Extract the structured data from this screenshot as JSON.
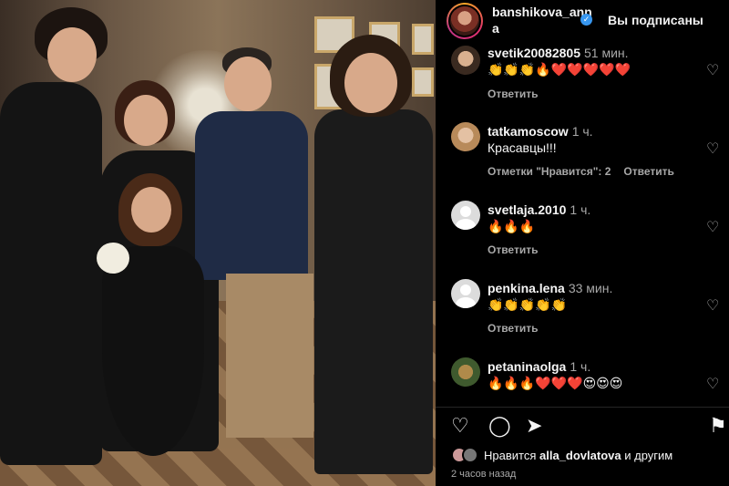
{
  "post": {
    "author": "banshikova_anna",
    "follow_status": "Вы подписаны",
    "verified_icon": "✓"
  },
  "comments": [
    {
      "user": "svetik20082805",
      "time": "51 мин.",
      "text": "👏👏👏🔥❤️❤️❤️❤️❤️",
      "reply": "Ответить",
      "likes": ""
    },
    {
      "user": "tatkamoscow",
      "time": "1 ч.",
      "text": "Красавцы!!!",
      "reply": "Ответить",
      "likes": "Отметки \"Нравится\": 2"
    },
    {
      "user": "svetlaja.2010",
      "time": "1 ч.",
      "text": "🔥🔥🔥",
      "reply": "Ответить",
      "likes": ""
    },
    {
      "user": "penkina.lena",
      "time": "33 мин.",
      "text": "👏👏👏👏👏",
      "reply": "Ответить",
      "likes": ""
    },
    {
      "user": "petaninaolga",
      "time": "1 ч.",
      "text": "🔥🔥🔥❤️❤️❤️😍😍😍",
      "reply": "",
      "likes": ""
    }
  ],
  "footer": {
    "likes_prefix": "Нравится",
    "likes_user": "alla_dovlatova",
    "likes_suffix": "и другим",
    "time_ago": "2 часов назад"
  },
  "icons": {
    "heart": "♡",
    "comment": "◯",
    "share": "➤",
    "bookmark": "⚑"
  },
  "colors": {
    "background": "#000000",
    "secondary_text": "#a8a8a8",
    "verified": "#3897f0"
  }
}
